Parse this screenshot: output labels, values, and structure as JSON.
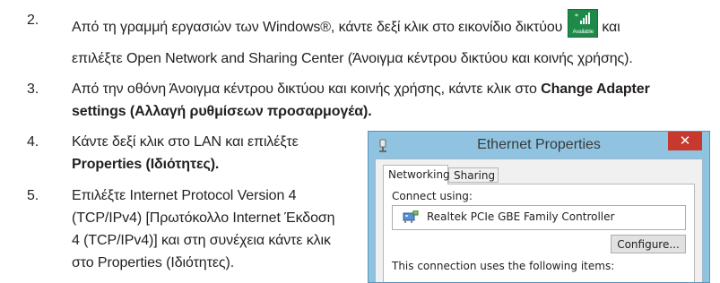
{
  "steps": [
    {
      "number": "2.",
      "line1_before_icon": "Από τη γραμμή εργασιών των Windows®, κάντε δεξί κλικ στο εικονίδιο δικτύου",
      "line1_after_icon": "και",
      "line2": "επιλέξτε Open Network and Sharing Center (Άνοιγμα κέντρου δικτύου και κοινής χρήσης).",
      "icon_label": "Available"
    },
    {
      "number": "3.",
      "line1_plain": "Από την οθόνη Άνοιγμα κέντρου δικτύου και κοινής χρήσης, κάντε κλικ στο ",
      "line1_bold": "Change Adapter",
      "line2_bold": "settings (Αλλαγή ρυθμίσεων προσαρμογέα)."
    },
    {
      "number": "4.",
      "line1": "Κάντε δεξί κλικ στο LAN και επιλέξτε",
      "line2_bold": "Properties (Ιδιότητες)."
    },
    {
      "number": "5.",
      "lines": [
        "Επιλέξτε Internet Protocol Version 4",
        "(TCP/IPv4) [Πρωτόκολλο Internet Έκδοση",
        "4 (TCP/IPv4)] και στη συνέχεια κάντε κλικ",
        "στο Properties (Ιδιότητες)."
      ]
    }
  ],
  "dialog": {
    "title": "Ethernet Properties",
    "close_glyph": "✕",
    "tabs": [
      "Networking",
      "Sharing"
    ],
    "connect_using_label": "Connect using:",
    "adapter_name": "Realtek PCIe GBE Family Controller",
    "configure_button": "Configure...",
    "items_label": "This connection uses the following items:"
  },
  "colors": {
    "text": "#231f20",
    "dialog_frame": "#8fc3e0",
    "close_button": "#c7392c",
    "network_icon": "#1e8a4a"
  }
}
